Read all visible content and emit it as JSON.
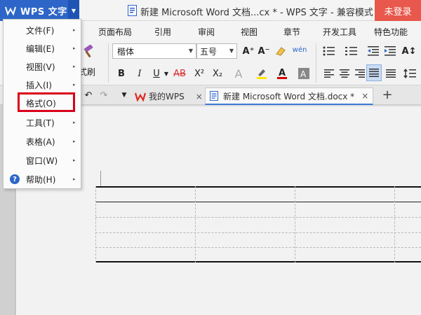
{
  "app": {
    "menu_button_label": "WPS 文字",
    "window_title": "新建 Microsoft Word 文档...cx * - WPS 文字 - 兼容模式",
    "login_label": "未登录"
  },
  "ribbon_tabs": [
    "页面布局",
    "引用",
    "审阅",
    "视图",
    "章节",
    "开发工具",
    "特色功能"
  ],
  "toolbar": {
    "font_name": "楷体",
    "font_size": "五号",
    "format_brush_label": "式刷",
    "bold": "B",
    "italic": "I",
    "underline": "U",
    "strikethrough": "AB",
    "superscript": "X²",
    "subscript": "X₂",
    "text_effect": "A",
    "grow_font": "A⁺",
    "shrink_font": "A⁻",
    "phonetic": "wén"
  },
  "doc_tabs": [
    {
      "label": "我的WPS",
      "close": "×"
    },
    {
      "label": "新建 Microsoft Word 文档.docx *",
      "close": "×"
    }
  ],
  "new_tab_symbol": "+",
  "menu": {
    "items": [
      {
        "label": "文件(F)",
        "has_submenu": true
      },
      {
        "label": "编辑(E)",
        "has_submenu": true
      },
      {
        "label": "视图(V)",
        "has_submenu": true
      },
      {
        "label": "插入(I)",
        "has_submenu": true
      },
      {
        "label": "格式(O)",
        "has_submenu": false,
        "highlighted": true
      },
      {
        "label": "工具(T)",
        "has_submenu": true
      },
      {
        "label": "表格(A)",
        "has_submenu": true
      },
      {
        "label": "窗口(W)",
        "has_submenu": true
      },
      {
        "label": "帮助(H)",
        "has_submenu": true
      }
    ],
    "submenu_arrow": "▸",
    "help_icon_glyph": "?"
  },
  "colors": {
    "wps_blue": "#2d66c8",
    "login_red": "#e8584c",
    "highlight_red": "#d9001b",
    "wps_logo_red": "#e0291f"
  }
}
